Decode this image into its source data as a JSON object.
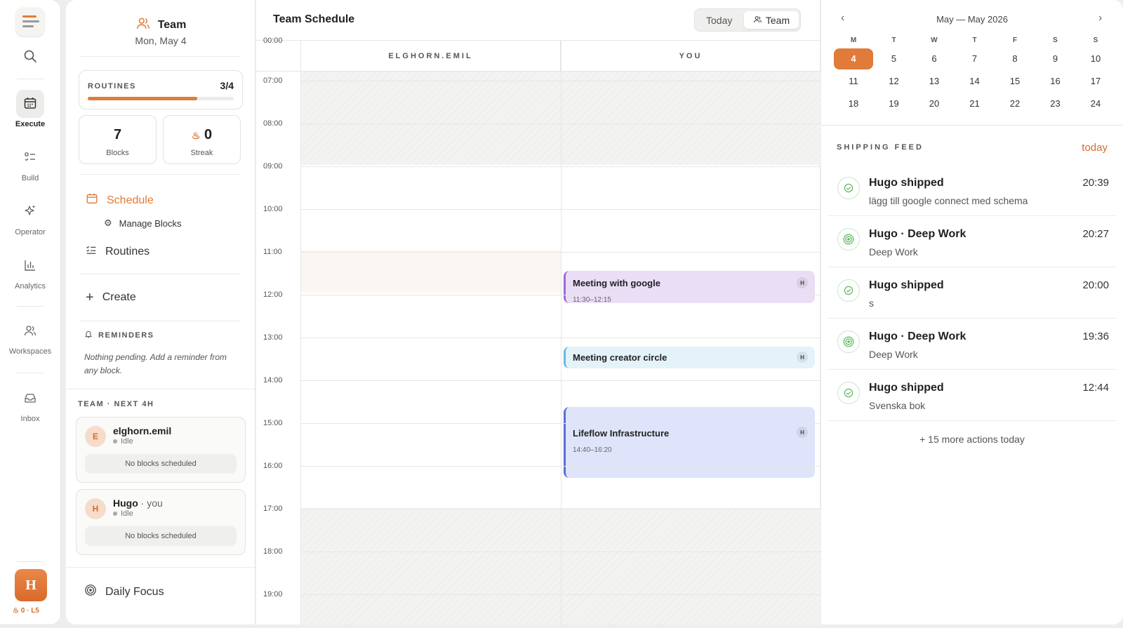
{
  "rail": {
    "items": [
      {
        "label": "Execute",
        "icon": "calendar-icon"
      },
      {
        "label": "Build",
        "icon": "list-icon"
      },
      {
        "label": "Operator",
        "icon": "sparkle-icon"
      },
      {
        "label": "Analytics",
        "icon": "bar-chart-icon"
      },
      {
        "label": "Workspaces",
        "icon": "users-icon"
      },
      {
        "label": "Inbox",
        "icon": "inbox-icon"
      }
    ],
    "avatar": "H",
    "status": "0 · L5"
  },
  "sidebar": {
    "title": "Team",
    "date": "Mon, May 4",
    "routines_label": "ROUTINES",
    "routines_value": "3/4",
    "routines_progress": 0.75,
    "blocks_value": "7",
    "blocks_label": "Blocks",
    "streak_value": "0",
    "streak_label": "Streak",
    "nav_schedule": "Schedule",
    "nav_manage": "Manage Blocks",
    "nav_routines": "Routines",
    "nav_create": "Create",
    "reminders_label": "REMINDERS",
    "reminders_text": "Nothing pending. Add a reminder from any block.",
    "team_label": "TEAM · NEXT 4H",
    "members": [
      {
        "initial": "E",
        "name": "elghorn.emil",
        "suffix": "",
        "status": "Idle",
        "blocks": "No blocks scheduled"
      },
      {
        "initial": "H",
        "name": "Hugo",
        "suffix": " · you",
        "status": "Idle",
        "blocks": "No blocks scheduled"
      }
    ],
    "daily_focus": "Daily Focus"
  },
  "main": {
    "title": "Team Schedule",
    "btn_today": "Today",
    "btn_team": "Team",
    "col1": "ELGHORN.EMIL",
    "col2": "YOU",
    "hours": [
      "07:00",
      "08:00",
      "09:00",
      "10:00",
      "11:00",
      "12:00",
      "13:00",
      "14:00",
      "15:00",
      "16:00",
      "17:00",
      "18:00",
      "19:00"
    ],
    "events": [
      {
        "title": "Meeting with google",
        "time": "11:30–12:15",
        "tag": "H",
        "color": "#e9def5",
        "border": "#9b6bd6"
      },
      {
        "title": "Meeting creator circle",
        "time": "",
        "tag": "H",
        "color": "#e4f2fa",
        "border": "#6ab8e0"
      },
      {
        "title": "Lifeflow Infrastructure",
        "time": "14:40–16:20",
        "tag": "H",
        "color": "#dfe4fa",
        "border": "#5a6fd6"
      }
    ]
  },
  "calendar": {
    "title": "May — May 2026",
    "weekdays": [
      "M",
      "T",
      "W",
      "T",
      "F",
      "S",
      "S"
    ],
    "weeks": [
      [
        "4",
        "5",
        "6",
        "7",
        "8",
        "9",
        "10"
      ],
      [
        "11",
        "12",
        "13",
        "14",
        "15",
        "16",
        "17"
      ],
      [
        "18",
        "19",
        "20",
        "21",
        "22",
        "23",
        "24"
      ]
    ],
    "selected": "4",
    "accent": "#e07b39"
  },
  "feed": {
    "label": "SHIPPING FEED",
    "filter": "today",
    "items": [
      {
        "title": "Hugo shipped",
        "sub": "lägg till google connect med schema",
        "time": "20:39",
        "kind": "check"
      },
      {
        "title": "Hugo · Deep Work",
        "sub": "Deep Work",
        "time": "20:27",
        "kind": "target"
      },
      {
        "title": "Hugo shipped",
        "sub": "s",
        "time": "20:00",
        "kind": "check"
      },
      {
        "title": "Hugo · Deep Work",
        "sub": "Deep Work",
        "time": "19:36",
        "kind": "target"
      },
      {
        "title": "Hugo shipped",
        "sub": "Svenska bok",
        "time": "12:44",
        "kind": "check"
      }
    ],
    "more": "+ 15 more actions today"
  }
}
